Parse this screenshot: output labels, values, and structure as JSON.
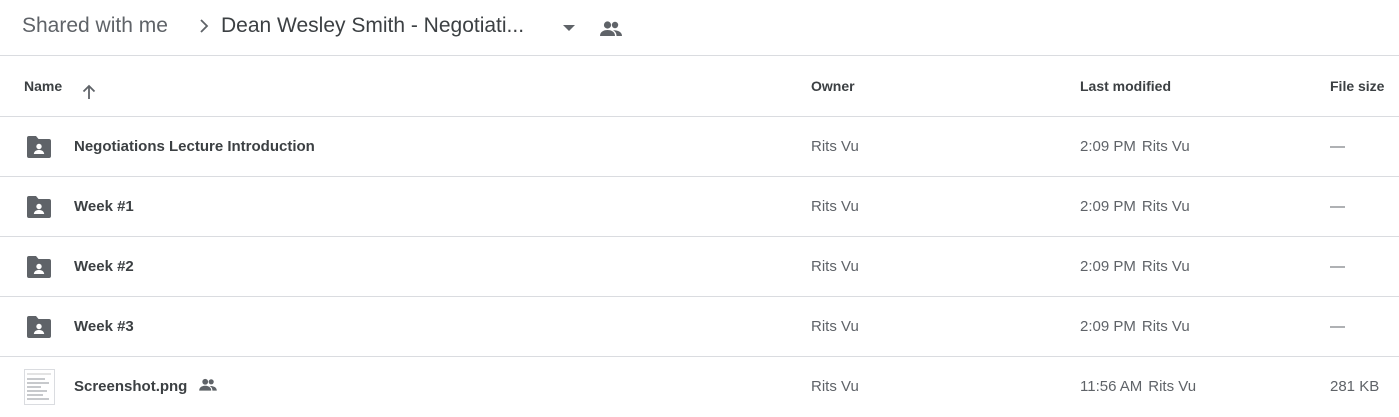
{
  "breadcrumb": {
    "root": "Shared with me",
    "current": "Dean Wesley Smith - Negotiati..."
  },
  "columns": {
    "name": "Name",
    "owner": "Owner",
    "last_modified": "Last modified",
    "file_size": "File size"
  },
  "rows": [
    {
      "name": "Negotiations Lecture Introduction",
      "owner": "Rits Vu",
      "modified_time": "2:09 PM",
      "modified_by": "Rits Vu",
      "size": "—",
      "type": "shared-folder-icon"
    },
    {
      "name": "Week #1",
      "owner": "Rits Vu",
      "modified_time": "2:09 PM",
      "modified_by": "Rits Vu",
      "size": "—",
      "type": "shared-folder-icon"
    },
    {
      "name": "Week #2",
      "owner": "Rits Vu",
      "modified_time": "2:09 PM",
      "modified_by": "Rits Vu",
      "size": "—",
      "type": "shared-folder-icon"
    },
    {
      "name": "Week #3",
      "owner": "Rits Vu",
      "modified_time": "2:09 PM",
      "modified_by": "Rits Vu",
      "size": "—",
      "type": "shared-folder-icon"
    },
    {
      "name": "Screenshot.png",
      "owner": "Rits Vu",
      "modified_time": "11:56 AM",
      "modified_by": "Rits Vu",
      "size": "281 KB",
      "type": "image-thumbnail"
    }
  ],
  "colors": {
    "icon_gray": "#5f6368",
    "divider": "#dadce0",
    "text": "#3c4043"
  }
}
